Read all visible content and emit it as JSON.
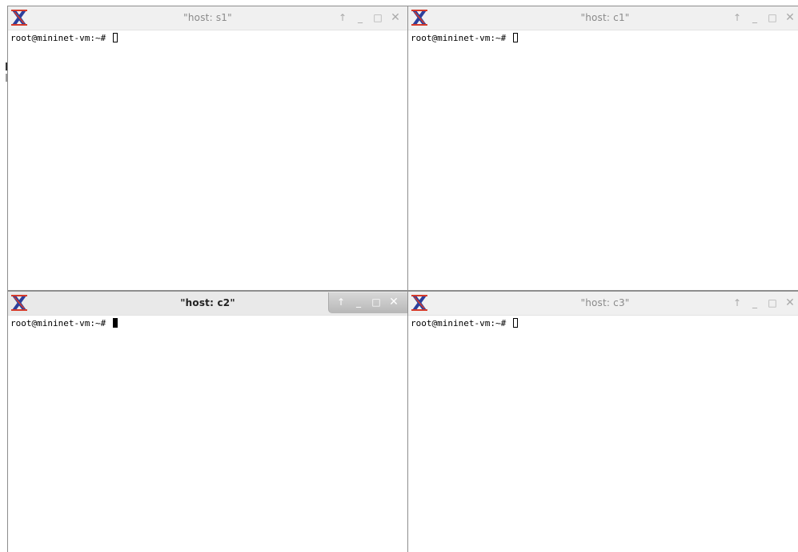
{
  "windows": [
    {
      "id": "s1",
      "title": "\"host: s1\"",
      "active": false,
      "terminal": {
        "prompt": "root@mininet-vm:~# ",
        "cursor": "hollow"
      },
      "controls": {
        "up": "↑",
        "minimize": "_",
        "maximize": "□",
        "close": "✕"
      }
    },
    {
      "id": "c1",
      "title": "\"host: c1\"",
      "active": false,
      "terminal": {
        "prompt": "root@mininet-vm:~# ",
        "cursor": "hollow"
      },
      "controls": {
        "up": "↑",
        "minimize": "_",
        "maximize": "□",
        "close": "✕"
      }
    },
    {
      "id": "c2",
      "title": "\"host: c2\"",
      "active": true,
      "terminal": {
        "prompt": "root@mininet-vm:~# ",
        "cursor": "filled"
      },
      "controls": {
        "up": "↑",
        "minimize": "_",
        "maximize": "□",
        "close": "✕"
      }
    },
    {
      "id": "c3",
      "title": "\"host: c3\"",
      "active": false,
      "terminal": {
        "prompt": "root@mininet-vm:~# ",
        "cursor": "hollow"
      },
      "controls": {
        "up": "↑",
        "minimize": "_",
        "maximize": "□",
        "close": "✕"
      }
    }
  ],
  "colors": {
    "xlogo_blue": "#2c3f9c",
    "xlogo_red": "#d63a2a",
    "titlebar_bg": "#f0f0f0",
    "active_controls_bg": "#bfbfbf"
  }
}
